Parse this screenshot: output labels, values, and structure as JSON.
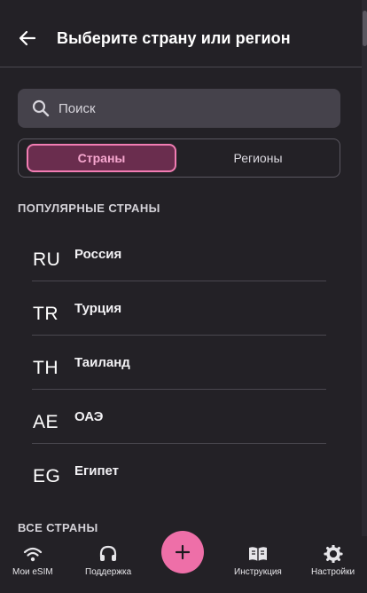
{
  "header": {
    "title": "Выберите страну или регион"
  },
  "search": {
    "placeholder": "Поиск"
  },
  "segments": {
    "countries": "Страны",
    "regions": "Регионы"
  },
  "sections": {
    "popular": "ПОПУЛЯРНЫЕ СТРАНЫ",
    "all": "ВСЕ СТРАНЫ"
  },
  "countries": [
    {
      "code": "RU",
      "name": "Россия"
    },
    {
      "code": "TR",
      "name": "Турция"
    },
    {
      "code": "TH",
      "name": "Таиланд"
    },
    {
      "code": "AE",
      "name": "ОАЭ"
    },
    {
      "code": "EG",
      "name": "Египет"
    }
  ],
  "nav": {
    "esim": "Мои eSIM",
    "support": "Поддержка",
    "guide": "Инструкция",
    "settings": "Настройки"
  },
  "colors": {
    "background": "#232126",
    "accent": "#ee6fa8",
    "search_bg": "#45424b",
    "active_tab_border": "#f27db3"
  }
}
